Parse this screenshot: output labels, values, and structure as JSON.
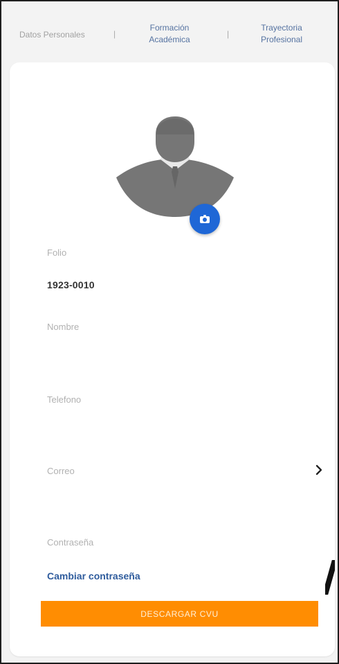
{
  "tabs": {
    "personal_label": "Datos Personales",
    "formacion_label": "Formación\nAcadémica",
    "trayectoria_label": "Trayectoria\nProfesional"
  },
  "profile": {
    "folio_label": "Folio",
    "folio_value": "1923-0010",
    "nombre_label": "Nombre",
    "telefono_label": "Telefono",
    "correo_label": "Correo",
    "contrasena_label": "Contraseña",
    "change_password_label": "Cambiar contraseña",
    "download_label": "DESCARGAR CVU"
  },
  "icons": {
    "avatar": "person-silhouette-icon",
    "camera": "camera-icon",
    "chevron": "chevron-right-icon"
  },
  "colors": {
    "accent": "#ff8d02",
    "link": "#2f5c9d",
    "camera_button": "#1f67d6",
    "avatar": "#767676"
  }
}
